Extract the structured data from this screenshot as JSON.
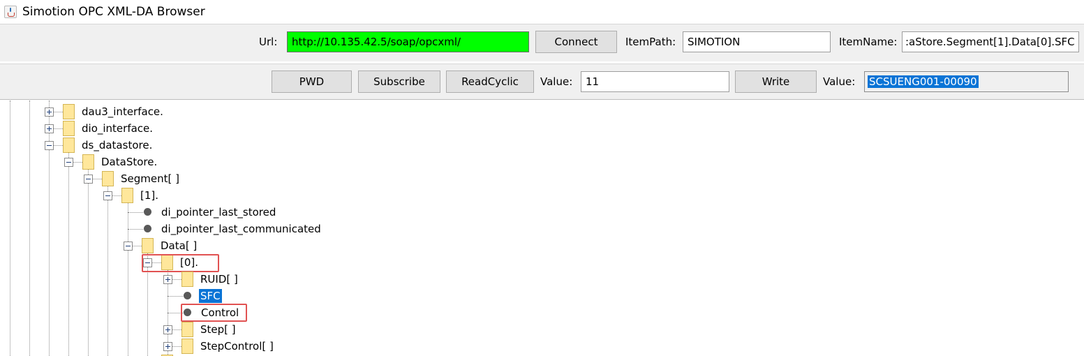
{
  "window": {
    "title": "Simotion OPC XML-DA Browser",
    "icon": "java-coffee-cup-icon"
  },
  "toolbar1": {
    "url_label": "Url:",
    "url_value": "http://10.135.42.5/soap/opcxml/",
    "connect_label": "Connect",
    "itempath_label": "ItemPath:",
    "itempath_value": "SIMOTION",
    "itemname_label": "ItemName:",
    "itemname_value": ":aStore.Segment[1].Data[0].SFC",
    "url_color": "#00ff00"
  },
  "toolbar2": {
    "pwd_label": "PWD",
    "subscribe_label": "Subscribe",
    "readcyclic_label": "ReadCyclic",
    "value_label": "Value:",
    "value_input": "11",
    "write_label": "Write",
    "value2_label": "Value:",
    "value2_output": "SCSUENG001-00090"
  },
  "tree": {
    "nodes": [
      {
        "label": "dau3_interface.",
        "type": "folder",
        "state": "collapsed"
      },
      {
        "label": "dio_interface.",
        "type": "folder",
        "state": "collapsed"
      },
      {
        "label": "ds_datastore.",
        "type": "folder",
        "state": "expanded"
      },
      {
        "label": "DataStore.",
        "type": "folder",
        "state": "expanded"
      },
      {
        "label": "Segment[ ]",
        "type": "folder",
        "state": "expanded"
      },
      {
        "label": "[1].",
        "type": "folder",
        "state": "expanded"
      },
      {
        "label": "di_pointer_last_stored",
        "type": "leaf"
      },
      {
        "label": "di_pointer_last_communicated",
        "type": "leaf"
      },
      {
        "label": "Data[ ]",
        "type": "folder",
        "state": "expanded"
      },
      {
        "label": "[0].",
        "type": "folder",
        "state": "expanded",
        "highlighted": true
      },
      {
        "label": "RUID[ ]",
        "type": "folder",
        "state": "collapsed"
      },
      {
        "label": "SFC",
        "type": "leaf",
        "selected": true
      },
      {
        "label": "Control",
        "type": "leaf",
        "highlighted": true
      },
      {
        "label": "Step[ ]",
        "type": "folder",
        "state": "collapsed"
      },
      {
        "label": "StepControl[ ]",
        "type": "folder",
        "state": "collapsed"
      }
    ],
    "selection_color": "#0a74d6",
    "highlight_color": "#e15252",
    "folder_color": "#ffe79b"
  }
}
